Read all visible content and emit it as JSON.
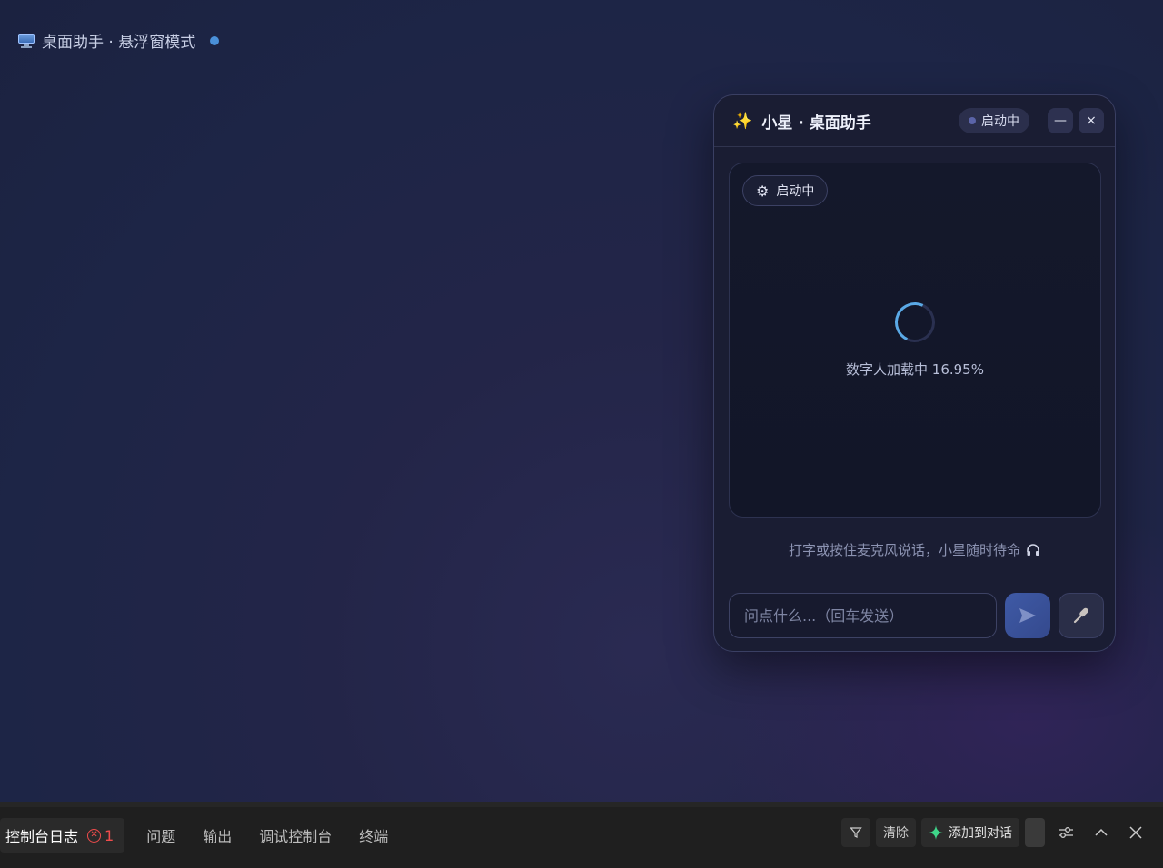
{
  "page": {
    "title": "桌面助手 · 悬浮窗模式",
    "title_icon": "monitor-icon",
    "status_dot_color": "#4a90d9"
  },
  "assistant": {
    "title": "小星 · 桌面助手",
    "title_icon": "sparkle-icon",
    "state_label": "启动中",
    "minimize_label": "—",
    "close_label": "×",
    "stage": {
      "status_label": "启动中",
      "status_icon": "gear-icon",
      "loading_text": "数字人加载中 16.95%",
      "loading_progress_percent": 16.95
    },
    "hint": "打字或按住麦克风说话，小星随时待命",
    "hint_icon": "headphones-icon",
    "input_placeholder": "问点什么...（回车发送）",
    "send_icon": "send-icon",
    "mic_icon": "microphone-icon",
    "accent_color": "#3f5aa6"
  },
  "panel": {
    "tabs": [
      {
        "label": "控制台日志",
        "active": true,
        "error_count": "1"
      },
      {
        "label": "问题",
        "active": false
      },
      {
        "label": "输出",
        "active": false
      },
      {
        "label": "调试控制台",
        "active": false
      },
      {
        "label": "终端",
        "active": false
      }
    ],
    "clear_label": "清除",
    "add_to_chat_label": "添加到对话",
    "error_color": "#f14c4c"
  }
}
